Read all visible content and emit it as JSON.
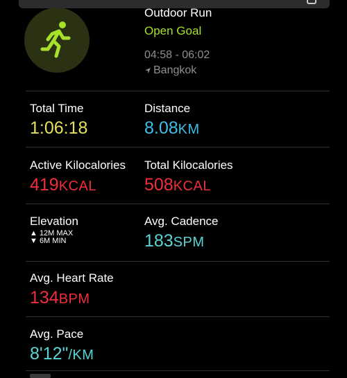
{
  "header": {
    "workout_title": "Outdoor Run",
    "goal": "Open Goal",
    "time_range": "04:58 - 06:02",
    "location": "Bangkok",
    "icon": "running-figure-icon",
    "accent_color": "#a6e22a"
  },
  "metrics": {
    "total_time": {
      "label": "Total Time",
      "value": "1:06:18",
      "unit": "",
      "color": "#e6e05a"
    },
    "distance": {
      "label": "Distance",
      "value": "8.08",
      "unit": "KM",
      "color": "#3fbfe6"
    },
    "active_kcal": {
      "label": "Active Kilocalories",
      "value": "419",
      "unit": "KCAL",
      "color": "#f02d3c"
    },
    "total_kcal": {
      "label": "Total Kilocalories",
      "value": "508",
      "unit": "KCAL",
      "color": "#f02d3c"
    },
    "elevation": {
      "label": "Elevation",
      "max": "▲ 12M MAX",
      "min": "▼ 6M MIN"
    },
    "avg_cadence": {
      "label": "Avg. Cadence",
      "value": "183",
      "unit": "SPM",
      "color": "#5ad4d6"
    },
    "avg_heart_rate": {
      "label": "Avg. Heart Rate",
      "value": "134",
      "unit": "BPM",
      "color": "#f02d3c"
    },
    "avg_pace": {
      "label": "Avg. Pace",
      "value": "8'12\"",
      "unit": "/KM",
      "color": "#5ad4d6"
    }
  }
}
